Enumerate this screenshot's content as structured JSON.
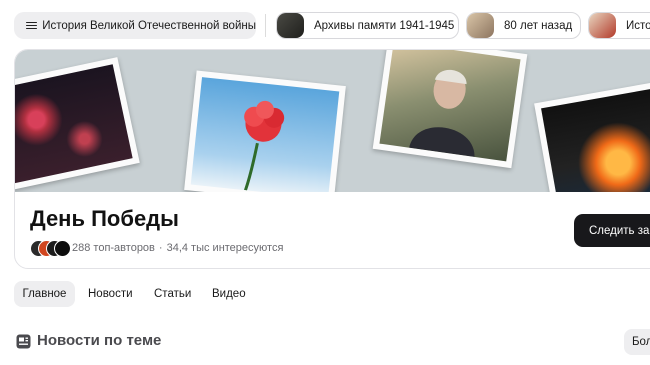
{
  "topbar": {
    "main_chip": {
      "label": "История Великой Отечественной войны",
      "icon": "menu-icon"
    },
    "chips": [
      {
        "label": "Архивы памяти 1941-1945"
      },
      {
        "label": "80 лет назад"
      },
      {
        "label": "Исто"
      }
    ]
  },
  "hero": {
    "title": "День Победы",
    "authors": "288 топ-авторов",
    "separator": "·",
    "interested": "34,4 тыс интересуются",
    "follow_label": "Следить за т"
  },
  "tabs": [
    {
      "label": "Главное",
      "active": true
    },
    {
      "label": "Новости"
    },
    {
      "label": "Статьи"
    },
    {
      "label": "Видео"
    }
  ],
  "section": {
    "title": "Новости по теме",
    "icon": "news-icon",
    "more_label": "Бол"
  },
  "colors": {
    "chip_bg": "#eeeef0",
    "button_dark": "#18181b",
    "banner_bg": "#c8d0d3"
  }
}
